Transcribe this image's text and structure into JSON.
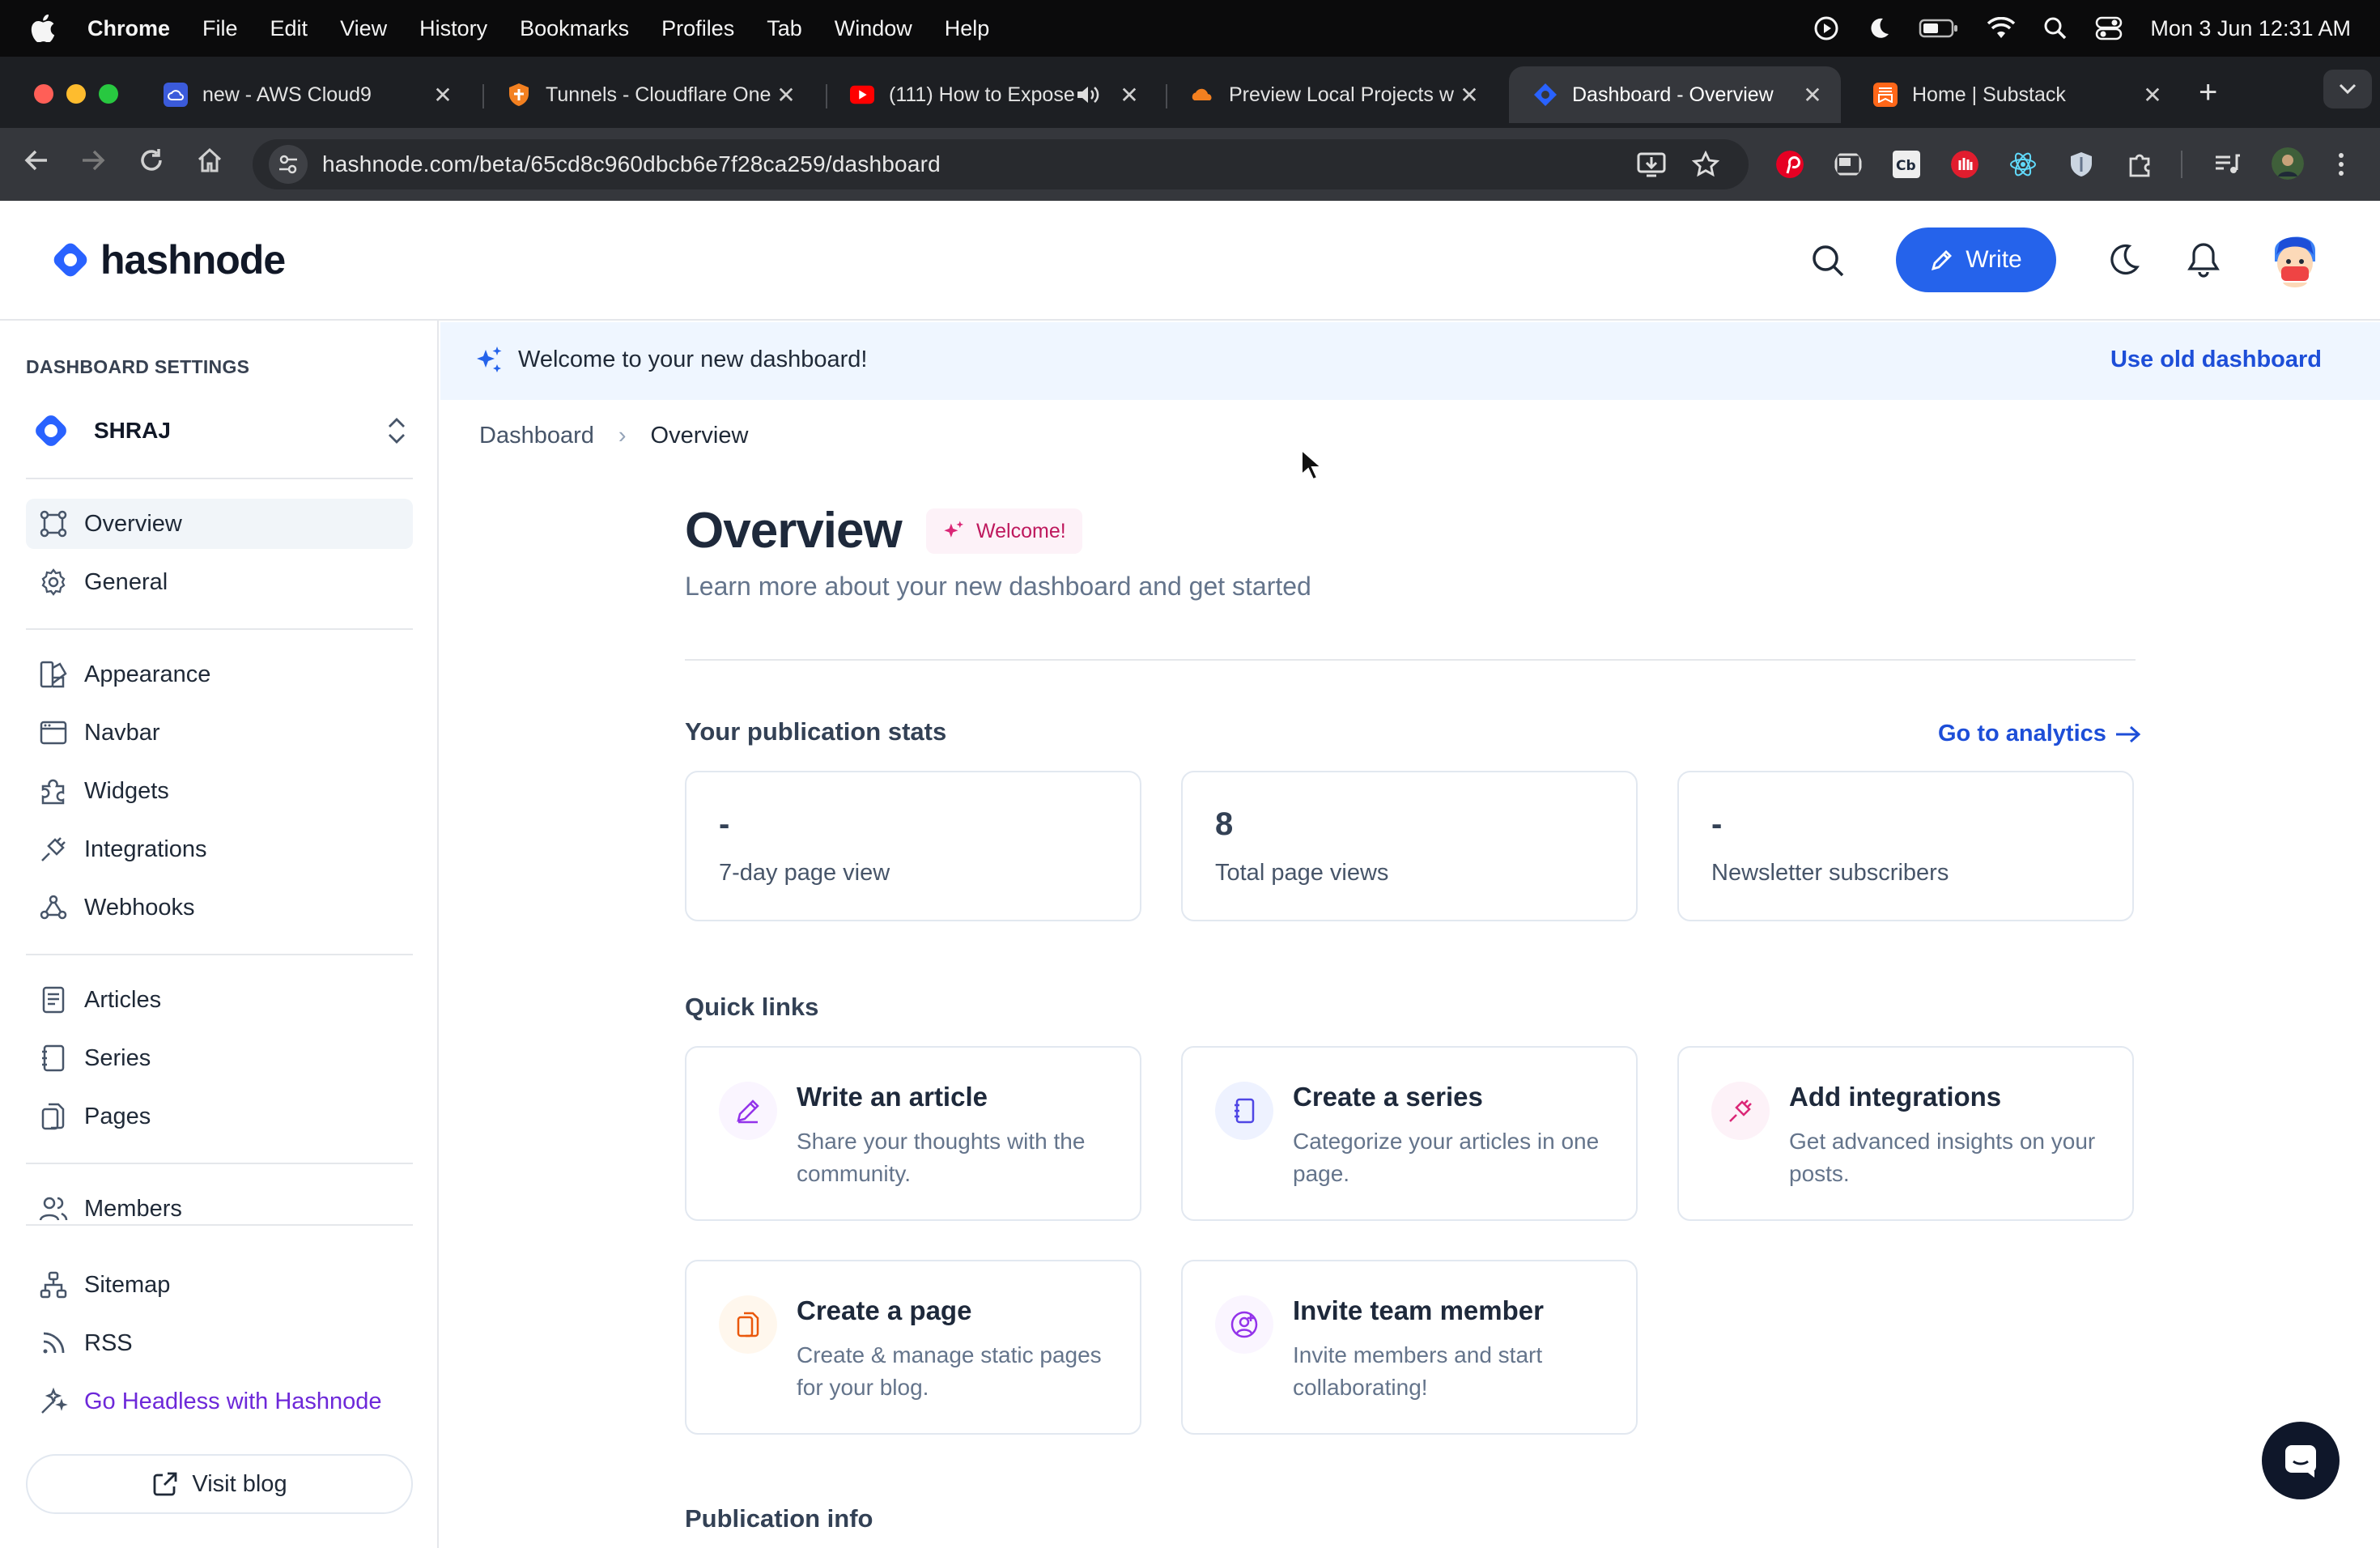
{
  "menubar": {
    "app": "Chrome",
    "items": [
      "File",
      "Edit",
      "View",
      "History",
      "Bookmarks",
      "Profiles",
      "Tab",
      "Window",
      "Help"
    ],
    "clock": "Mon 3 Jun  12:31 AM"
  },
  "tabs": [
    {
      "title": "new - AWS Cloud9",
      "icon": "cloud9-icon"
    },
    {
      "title": "Tunnels - Cloudflare One",
      "icon": "cloudflare-shield-icon"
    },
    {
      "title": "(111) How to Expose",
      "icon": "youtube-icon"
    },
    {
      "title": "Preview Local Projects w",
      "icon": "cloudflare-icon"
    },
    {
      "title": "Dashboard - Overview",
      "icon": "hashnode-icon"
    },
    {
      "title": "Home | Substack",
      "icon": "substack-icon"
    }
  ],
  "toolbar": {
    "url": "hashnode.com/beta/65cd8c960dbcb6e7f28ca259/dashboard"
  },
  "header": {
    "logo": "hashnode",
    "write_label": "Write"
  },
  "sidebar": {
    "heading": "DASHBOARD SETTINGS",
    "publication": "SHRAJ",
    "items": [
      {
        "label": "Overview"
      },
      {
        "label": "General"
      },
      {
        "label": "Appearance"
      },
      {
        "label": "Navbar"
      },
      {
        "label": "Widgets"
      },
      {
        "label": "Integrations"
      },
      {
        "label": "Webhooks"
      },
      {
        "label": "Articles"
      },
      {
        "label": "Series"
      },
      {
        "label": "Pages"
      },
      {
        "label": "Members"
      },
      {
        "label": "Sitemap"
      },
      {
        "label": "RSS"
      },
      {
        "label": "Go Headless with Hashnode"
      }
    ],
    "visit_blog": "Visit blog"
  },
  "banner": {
    "message": "Welcome to your new dashboard!",
    "old_dashboard": "Use old dashboard"
  },
  "breadcrumb": {
    "root": "Dashboard",
    "current": "Overview"
  },
  "main": {
    "title": "Overview",
    "badge": "Welcome!",
    "subtitle": "Learn more about your new dashboard and get started",
    "stats_title": "Your publication stats",
    "analytics_link": "Go to analytics",
    "stats": [
      {
        "value": "-",
        "label": "7-day page view"
      },
      {
        "value": "8",
        "label": "Total page views"
      },
      {
        "value": "-",
        "label": "Newsletter subscribers"
      }
    ],
    "quick_links_title": "Quick links",
    "quick_links": [
      {
        "title": "Write an article",
        "desc": "Share your thoughts with the community.",
        "icon": "pencil-icon"
      },
      {
        "title": "Create a series",
        "desc": "Categorize your articles in one page.",
        "icon": "notebook-icon"
      },
      {
        "title": "Add integrations",
        "desc": "Get advanced insights on your posts.",
        "icon": "plug-icon"
      },
      {
        "title": "Create a page",
        "desc": "Create & manage static pages for your blog.",
        "icon": "pages-icon"
      },
      {
        "title": "Invite team member",
        "desc": "Invite members and start collaborating!",
        "icon": "user-plus-icon"
      }
    ],
    "publication_info_title": "Publication info"
  },
  "colors": {
    "accent": "#2563eb",
    "banner_bg": "#eff6ff",
    "badge_text": "#be185d",
    "headless_link": "#6d28d9"
  }
}
